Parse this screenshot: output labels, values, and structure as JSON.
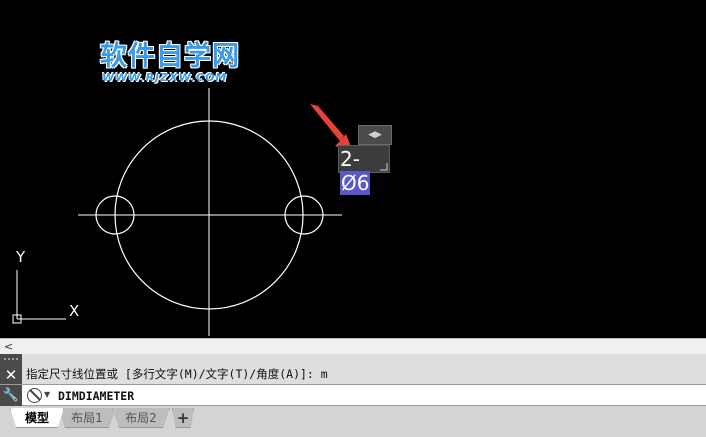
{
  "watermark": {
    "title": "软件自学网",
    "url": "WWW.RJZXW.COM"
  },
  "editor": {
    "prefix": "2-",
    "selected": "Ø6",
    "arrows": "◀▶"
  },
  "ucs": {
    "x_label": "X",
    "y_label": "Y"
  },
  "scroll": {
    "left_arrow": "<"
  },
  "command": {
    "history": "指定尺寸线位置或 [多行文字(M)/文字(T)/角度(A)]: m",
    "close_glyph": "✕",
    "input": "DIMDIAMETER",
    "tool_glyph": "🔧"
  },
  "tabs": [
    {
      "label": "模型",
      "active": true
    },
    {
      "label": "布局1",
      "active": false
    },
    {
      "label": "布局2",
      "active": false
    }
  ],
  "tab_add": "+",
  "colors": {
    "background": "#000000",
    "geometry": "#ffffff",
    "annotation_arrow": "#e8413a",
    "selection": "#5b57c8",
    "watermark": "#3a9ae6"
  }
}
